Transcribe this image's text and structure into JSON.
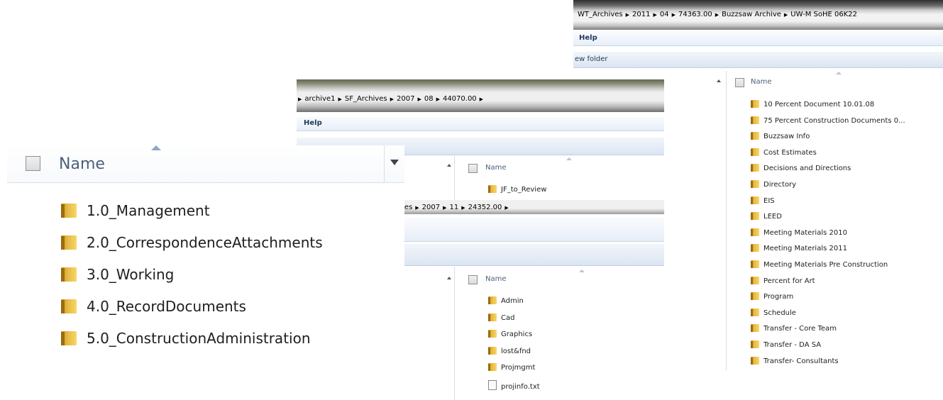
{
  "window_right": {
    "breadcrumb": [
      "WT_Archives",
      "2011",
      "04",
      "74363.00",
      "Buzzsaw Archive",
      "UW-M SoHE 06K22"
    ],
    "menu": "Help",
    "toolbar": "ew folder",
    "column_header": "Name",
    "items": [
      {
        "name": "10 Percent Document 10.01.08",
        "icon": "folder-icon"
      },
      {
        "name": "75 Percent Construction Documents 0...",
        "icon": "folder-icon"
      },
      {
        "name": "Buzzsaw Info",
        "icon": "folder-icon"
      },
      {
        "name": "Cost Estimates",
        "icon": "folder-icon"
      },
      {
        "name": "Decisions and Directions",
        "icon": "folder-icon"
      },
      {
        "name": "Directory",
        "icon": "folder-icon"
      },
      {
        "name": "EIS",
        "icon": "folder-icon"
      },
      {
        "name": "LEED",
        "icon": "folder-icon"
      },
      {
        "name": "Meeting Materials 2010",
        "icon": "folder-icon"
      },
      {
        "name": "Meeting Materials 2011",
        "icon": "folder-icon"
      },
      {
        "name": "Meeting Materials Pre Construction",
        "icon": "folder-icon"
      },
      {
        "name": "Percent for Art",
        "icon": "folder-icon"
      },
      {
        "name": "Program",
        "icon": "folder-icon"
      },
      {
        "name": "Schedule",
        "icon": "folder-icon"
      },
      {
        "name": "Transfer - Core Team",
        "icon": "folder-icon"
      },
      {
        "name": "Transfer - DA SA",
        "icon": "folder-icon"
      },
      {
        "name": "Transfer- Consultants",
        "icon": "folder-icon"
      }
    ]
  },
  "window_middle_top": {
    "breadcrumb": [
      "archive1",
      "SF_Archives",
      "2007",
      "08",
      "44070.00"
    ],
    "menu": "Help",
    "column_header": "Name",
    "items": [
      {
        "name": "JF_to_Review",
        "icon": "folder-icon"
      }
    ]
  },
  "window_middle_bottom": {
    "breadcrumb": [
      "ves",
      "2007",
      "11",
      "24352.00"
    ],
    "column_header": "Name",
    "items": [
      {
        "name": "Admin",
        "icon": "folder-icon"
      },
      {
        "name": "Cad",
        "icon": "folder-icon"
      },
      {
        "name": "Graphics",
        "icon": "folder-icon"
      },
      {
        "name": "lost&fnd",
        "icon": "folder-icon"
      },
      {
        "name": "Projmgmt",
        "icon": "folder-icon"
      },
      {
        "name": "projinfo.txt",
        "icon": "text-file-icon"
      }
    ]
  },
  "window_front": {
    "column_header": "Name",
    "items": [
      {
        "name": "1.0_Management",
        "icon": "folder-icon"
      },
      {
        "name": "2.0_CorrespondenceAttachments",
        "icon": "folder-icon"
      },
      {
        "name": "3.0_Working",
        "icon": "folder-icon"
      },
      {
        "name": "4.0_RecordDocuments",
        "icon": "folder-icon"
      },
      {
        "name": "5.0_ConstructionAdministration",
        "icon": "folder-icon"
      }
    ]
  }
}
